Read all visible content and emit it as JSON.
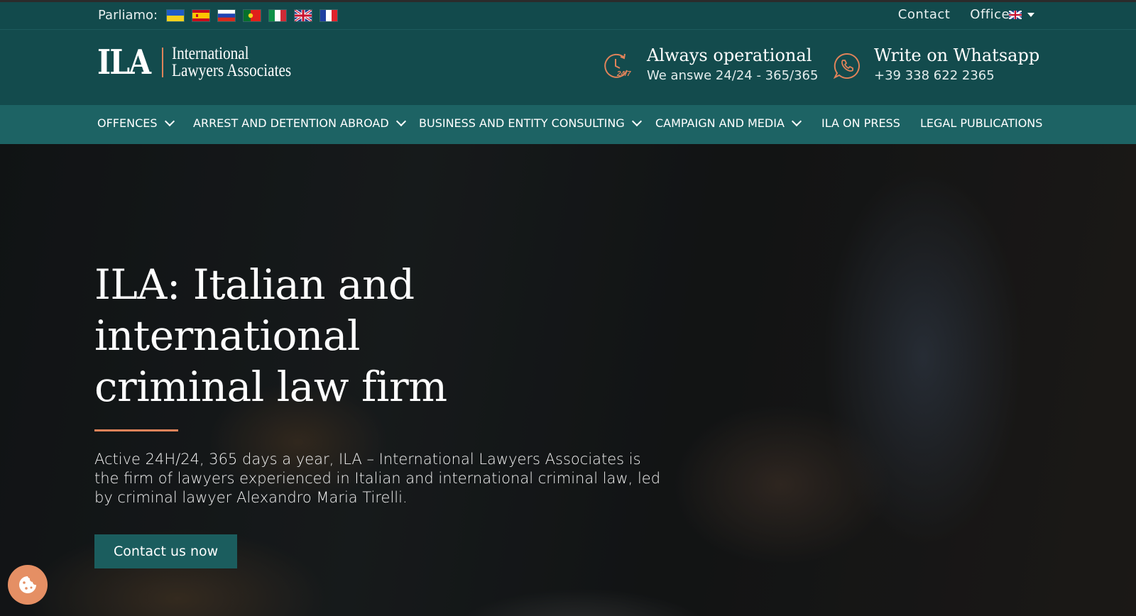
{
  "topbar": {
    "parliamo_label": "Parliamo:",
    "flags": [
      "ukraine-flag-icon",
      "spain-flag-icon",
      "russia-flag-icon",
      "portugal-flag-icon",
      "italy-flag-icon",
      "uk-flag-icon",
      "france-flag-icon"
    ],
    "contact_link": "Contact",
    "offices_link": "Offices",
    "language_selector_icon": "uk-flag-icon"
  },
  "header": {
    "logo_mark": "ILA",
    "logo_text_line1": "International",
    "logo_text_line2": "Lawyers Associates",
    "operational_title": "Always operational",
    "operational_sub": "We answe 24/24 - 365/365",
    "whatsapp_title": "Write on Whatsapp",
    "whatsapp_phone": "+39 338 622 2365"
  },
  "nav": {
    "items": [
      {
        "label": "OFFENCES",
        "dropdown": true
      },
      {
        "label": "ARREST AND DETENTION ABROAD",
        "dropdown": true
      },
      {
        "label": "BUSINESS AND ENTITY CONSULTING",
        "dropdown": true
      },
      {
        "label": "CAMPAIGN AND MEDIA",
        "dropdown": true
      },
      {
        "label": "ILA ON PRESS",
        "dropdown": false
      },
      {
        "label": "LEGAL PUBLICATIONS",
        "dropdown": false
      }
    ]
  },
  "hero": {
    "title_line1": "ILA: Italian and international",
    "title_line2": "criminal law firm",
    "description": "Active 24H/24, 365 days a year, ILA – International Lawyers Associates is the firm of lawyers experienced in Italian and international criminal law, led by criminal lawyer Alexandro Maria Tirelli.",
    "cta_label": "Contact us now"
  },
  "colors": {
    "topbar_bg": "#124a4c",
    "header_bg": "#134b4d",
    "nav_bg": "#1d6364",
    "accent_orange": "#e0835a",
    "cta_bg": "#1b5d5e",
    "cookie_bg": "#e58f64"
  },
  "cookie_icon": "cookie-icon"
}
